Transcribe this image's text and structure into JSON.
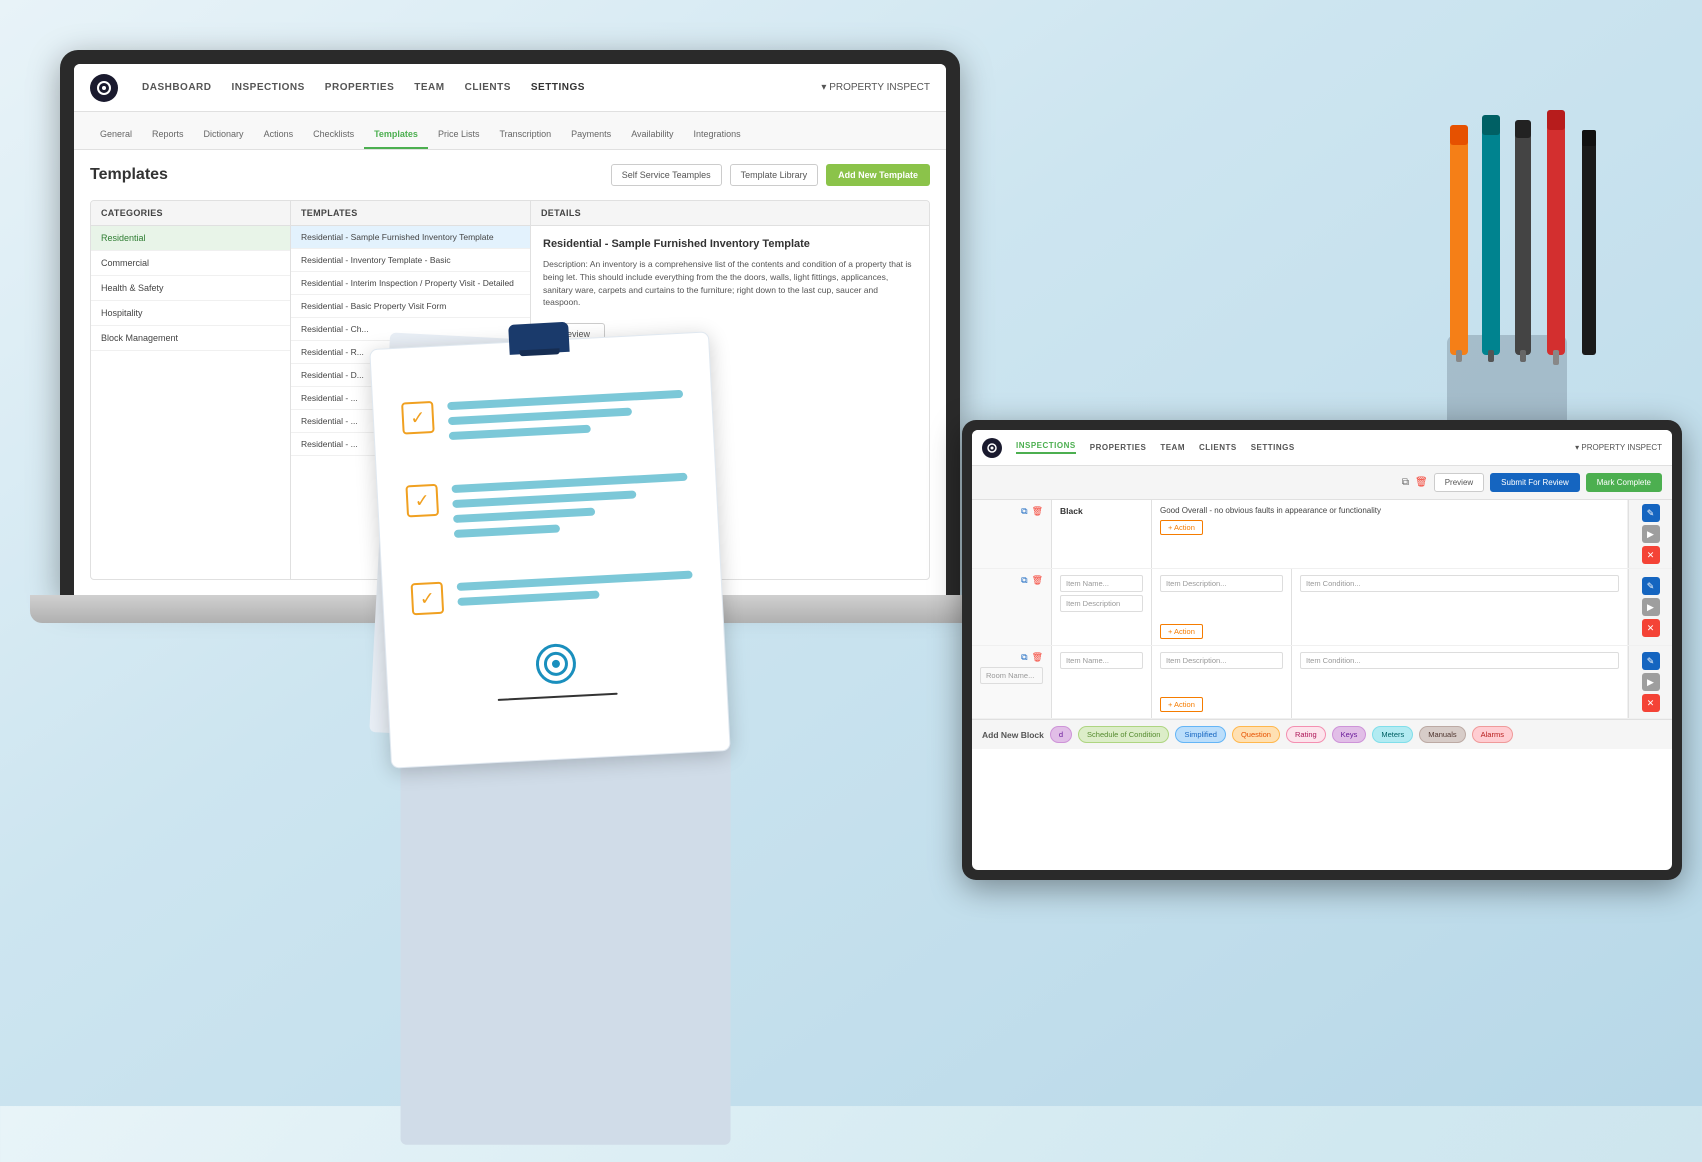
{
  "background": {
    "color": "#d8eaf2"
  },
  "laptop": {
    "nav": {
      "logo_text": "PI",
      "items": [
        {
          "label": "DASHBOARD",
          "active": false
        },
        {
          "label": "INSPECTIONS",
          "active": false
        },
        {
          "label": "PROPERTIES",
          "active": false
        },
        {
          "label": "TEAM",
          "active": false
        },
        {
          "label": "CLIENTS",
          "active": false
        },
        {
          "label": "SETTINGS",
          "active": true
        }
      ],
      "right": "▾ PROPERTY INSPECT"
    },
    "settings_tabs": [
      {
        "label": "General"
      },
      {
        "label": "Reports"
      },
      {
        "label": "Dictionary"
      },
      {
        "label": "Actions"
      },
      {
        "label": "Checklists"
      },
      {
        "label": "Templates",
        "active": true
      },
      {
        "label": "Price Lists"
      },
      {
        "label": "Transcription"
      },
      {
        "label": "Payments"
      },
      {
        "label": "Availability"
      },
      {
        "label": "Integrations"
      }
    ],
    "page_title": "Templates",
    "btn_self_service": "Self Service Teamples",
    "btn_template_library": "Template Library",
    "btn_add_new": "Add New Template",
    "categories_header": "Categories",
    "templates_header": "Templates",
    "details_header": "Details",
    "categories": [
      {
        "label": "Residential",
        "selected": true
      },
      {
        "label": "Commercial"
      },
      {
        "label": "Health & Safety"
      },
      {
        "label": "Hospitality"
      },
      {
        "label": "Block Management"
      }
    ],
    "templates": [
      {
        "label": "Residential - Sample Furnished Inventory Template",
        "selected": true
      },
      {
        "label": "Residential - Inventory Template - Basic"
      },
      {
        "label": "Residential - Interim Inspection / Property Visit - Detailed"
      },
      {
        "label": "Residential - Basic Property Visit Form"
      },
      {
        "label": "Residential - Ch..."
      },
      {
        "label": "Residential - R..."
      },
      {
        "label": "Residential - D..."
      },
      {
        "label": "Residential - ..."
      },
      {
        "label": "Residential - ..."
      },
      {
        "label": "Residential - ..."
      }
    ],
    "details_title": "Residential - Sample Furnished Inventory Template",
    "details_description": "Description: An inventory is a comprehensive list of the contents and condition of a property that is being let. This should include everything from the the doors, walls, light fittings, applicances, sanitary ware, carpets and curtains to the furniture; right down to the last cup, saucer and teaspoon.",
    "btn_preview": "Preview"
  },
  "tablet": {
    "nav": {
      "items": [
        {
          "label": "INSPECTIONS",
          "active": true
        },
        {
          "label": "PROPERTIES"
        },
        {
          "label": "TEAM"
        },
        {
          "label": "CLIENTS"
        },
        {
          "label": "SETTINGS"
        }
      ],
      "right": "▾ PROPERTY INSPECT"
    },
    "toolbar": {
      "btn_preview": "Preview",
      "btn_submit": "Submit For Review",
      "btn_complete": "Mark Complete"
    },
    "form_rows": [
      {
        "col1": "Black",
        "col2": "Good Overall - no obvious faults in appearance or functionality",
        "action": "+ Action"
      },
      {
        "col1_placeholder": "Item Name...",
        "col2_placeholder": "Item Description",
        "col3_placeholder": "Item Description...",
        "col4_placeholder": "Item Condition...",
        "action": "+ Action"
      },
      {
        "col1_placeholder": "Room Name...",
        "col2_placeholder": "Item Name...",
        "col3_placeholder": "Item Description...",
        "col4_placeholder": "Item Condition...",
        "action": "+ Action"
      }
    ],
    "add_block_label": "Add New Block",
    "block_types": [
      {
        "label": "d",
        "color": "#9c27b0"
      },
      {
        "label": "Schedule of Condition",
        "color": "#8bc34a"
      },
      {
        "label": "Simplified",
        "color": "#2196f3"
      },
      {
        "label": "Question",
        "color": "#ff9800"
      },
      {
        "label": "Rating",
        "color": "#e91e63"
      },
      {
        "label": "Keys",
        "color": "#9c27b0"
      },
      {
        "label": "Meters",
        "color": "#00bcd4"
      },
      {
        "label": "Manuals",
        "color": "#795548"
      },
      {
        "label": "Alarms",
        "color": "#f44336"
      }
    ]
  },
  "checklist": {
    "rows": [
      {
        "checked": true,
        "lines": [
          100,
          75,
          55
        ]
      },
      {
        "checked": true,
        "lines": [
          100,
          80,
          60,
          45
        ]
      },
      {
        "checked": true,
        "lines": [
          100,
          70
        ]
      }
    ]
  }
}
